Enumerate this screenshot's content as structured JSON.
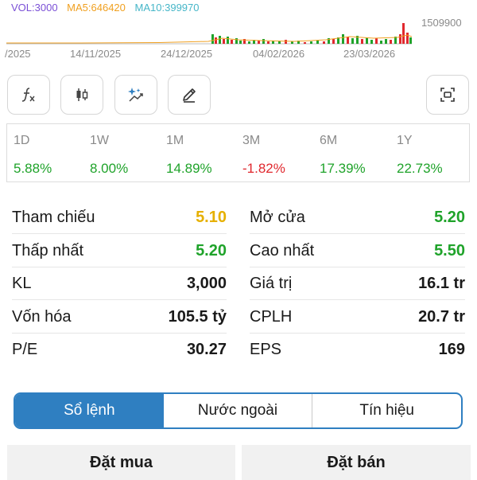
{
  "colors": {
    "up": "#1fa32a",
    "down": "#e0282e",
    "reference": "#e6b000",
    "accent": "#2f7fc1",
    "vol": "#7a4fd6",
    "ma5": "#f0a020",
    "ma10": "#46b6c8"
  },
  "volume_chart": {
    "legend": {
      "vol": "VOL:3000",
      "ma5": "MA5:646420",
      "ma10": "MA10:399970"
    },
    "y_max_label": "1509900",
    "dates": [
      "/2025",
      "14/11/2025",
      "24/12/2025",
      "04/02/2026",
      "23/03/2026"
    ]
  },
  "toolbar": {
    "indicator_icon": "function-icon",
    "candle_icon": "candlestick-icon",
    "ai_icon": "sparkle-chart-icon",
    "draw_icon": "pencil-icon",
    "capture_icon": "screenshot-icon"
  },
  "performance": [
    {
      "period": "1D",
      "change": "5.88%",
      "trend": "up"
    },
    {
      "period": "1W",
      "change": "8.00%",
      "trend": "up"
    },
    {
      "period": "1M",
      "change": "14.89%",
      "trend": "up"
    },
    {
      "period": "3M",
      "change": "-1.82%",
      "trend": "down"
    },
    {
      "period": "6M",
      "change": "17.39%",
      "trend": "up"
    },
    {
      "period": "1Y",
      "change": "22.73%",
      "trend": "up"
    }
  ],
  "stats": {
    "left": [
      {
        "label": "Tham chiếu",
        "value": "5.10",
        "tone": "reference"
      },
      {
        "label": "Thấp nhất",
        "value": "5.20",
        "tone": "up"
      },
      {
        "label": "KL",
        "value": "3,000",
        "tone": "plain"
      },
      {
        "label": "Vốn hóa",
        "value": "105.5 tỷ",
        "tone": "plain"
      },
      {
        "label": "P/E",
        "value": "30.27",
        "tone": "plain"
      }
    ],
    "right": [
      {
        "label": "Mở cửa",
        "value": "5.20",
        "tone": "up"
      },
      {
        "label": "Cao nhất",
        "value": "5.50",
        "tone": "up"
      },
      {
        "label": "Giá trị",
        "value": "16.1 tr",
        "tone": "plain"
      },
      {
        "label": "CPLH",
        "value": "20.7 tr",
        "tone": "plain"
      },
      {
        "label": "EPS",
        "value": "169",
        "tone": "plain"
      }
    ]
  },
  "tabs": [
    {
      "label": "Sổ lệnh",
      "active": true
    },
    {
      "label": "Nước ngoài",
      "active": false
    },
    {
      "label": "Tín hiệu",
      "active": false
    }
  ],
  "orders": {
    "buy_label": "Đặt mua",
    "sell_label": "Đặt bán"
  }
}
